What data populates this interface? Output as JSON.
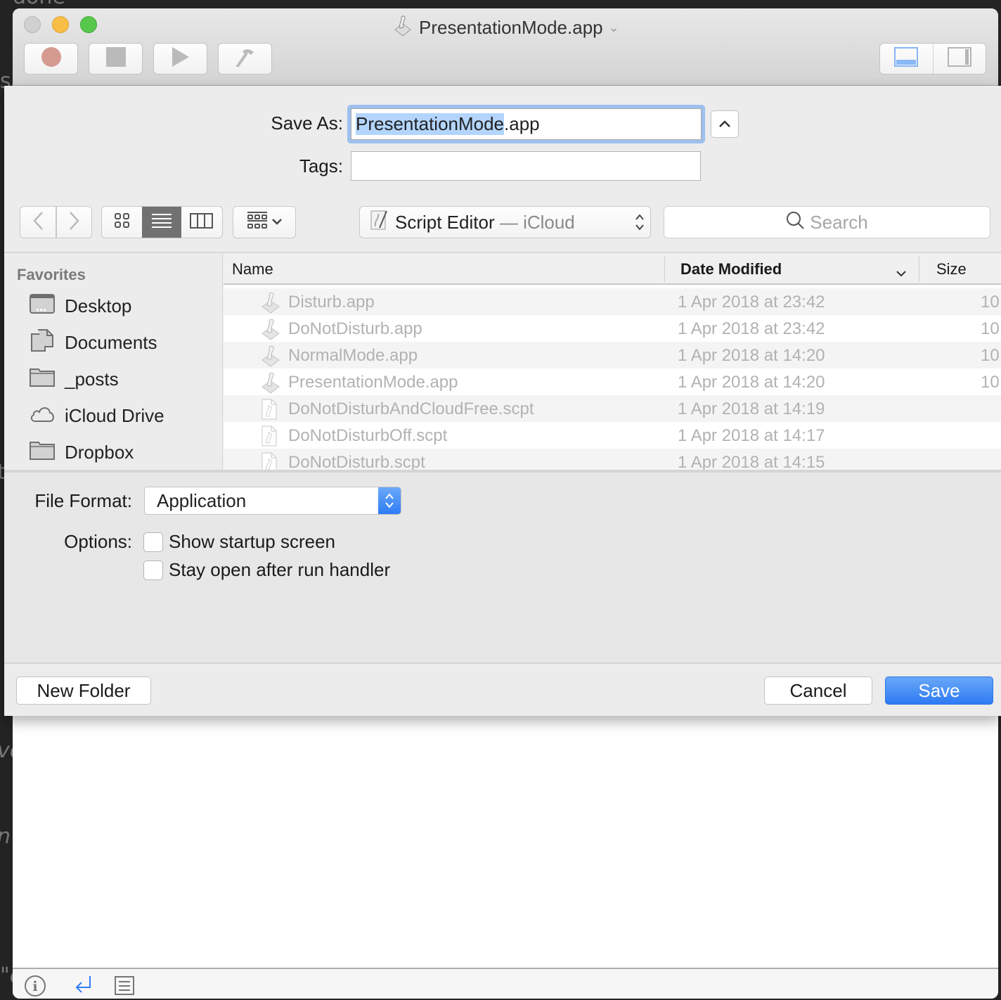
{
  "background": {
    "editor_fragments": [
      "done",
      "sa",
      "t",
      "ve",
      "n",
      "\"c"
    ]
  },
  "window": {
    "title": "PresentationMode.app",
    "toolbar": {
      "buttons": [
        {
          "name": "record",
          "icon": "record-icon"
        },
        {
          "name": "stop",
          "icon": "stop-icon"
        },
        {
          "name": "run",
          "icon": "play-icon"
        },
        {
          "name": "compile",
          "icon": "hammer-icon"
        }
      ],
      "view_toggle": [
        "show-bottom-pane-icon",
        "show-side-pane-icon"
      ]
    },
    "bottom_bar": [
      "info-icon",
      "return-icon",
      "list-icon"
    ]
  },
  "save_dialog": {
    "save_as_label": "Save As:",
    "save_as_value_selected": "PresentationMode",
    "save_as_value_rest": ".app",
    "tags_label": "Tags:",
    "tags_value": "",
    "location": {
      "app": "Script Editor",
      "separator": " — ",
      "service": "iCloud"
    },
    "search_placeholder": "Search",
    "sidebar": {
      "heading": "Favorites",
      "items": [
        {
          "label": "Desktop",
          "icon": "desktop-icon"
        },
        {
          "label": "Documents",
          "icon": "documents-icon"
        },
        {
          "label": "_posts",
          "icon": "folder-icon"
        },
        {
          "label": "iCloud Drive",
          "icon": "cloud-icon"
        },
        {
          "label": "Dropbox",
          "icon": "folder-icon"
        }
      ]
    },
    "columns": {
      "name": "Name",
      "date": "Date Modified",
      "size": "Size"
    },
    "files": [
      {
        "name": "Disturb.app",
        "date": "1 Apr 2018 at 23:42",
        "size": "10",
        "type": "app"
      },
      {
        "name": "DoNotDisturb.app",
        "date": "1 Apr 2018 at 23:42",
        "size": "10",
        "type": "app"
      },
      {
        "name": "NormalMode.app",
        "date": "1 Apr 2018 at 14:20",
        "size": "10",
        "type": "app"
      },
      {
        "name": "PresentationMode.app",
        "date": "1 Apr 2018 at 14:20",
        "size": "10",
        "type": "app"
      },
      {
        "name": "DoNotDisturbAndCloudFree.scpt",
        "date": "1 Apr 2018 at 14:19",
        "size": "",
        "type": "script"
      },
      {
        "name": "DoNotDisturbOff.scpt",
        "date": "1 Apr 2018 at 14:17",
        "size": "",
        "type": "script"
      },
      {
        "name": "DoNotDisturb.scpt",
        "date": "1 Apr 2018 at 14:15",
        "size": "",
        "type": "script"
      }
    ],
    "file_format_label": "File Format:",
    "file_format_value": "Application",
    "options_label": "Options:",
    "options": [
      {
        "label": "Show startup screen",
        "checked": false
      },
      {
        "label": "Stay open after run handler",
        "checked": false
      }
    ],
    "new_folder_label": "New Folder",
    "cancel_label": "Cancel",
    "save_label": "Save",
    "colors": {
      "accent": "#2e7af4",
      "selection": "#b3d5fd",
      "focus_ring": "#9dc0ee"
    }
  }
}
